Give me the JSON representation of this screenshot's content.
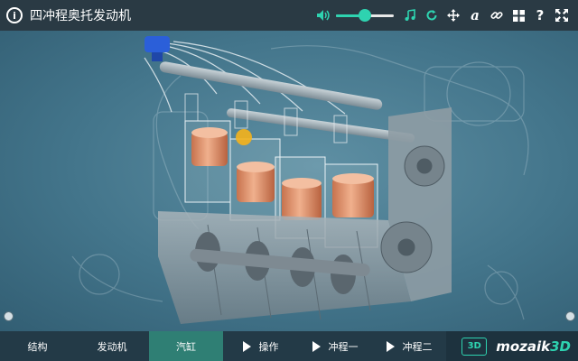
{
  "app": {
    "title": "四冲程奥托发动机",
    "info_glyph": "i"
  },
  "toolbar": {
    "volume_icon": "speaker-icon",
    "volume_level": 0.5,
    "music_icon": "music-note-icon",
    "reset_icon": "rotate-icon",
    "move_icon": "move-arrows-icon",
    "label_glyph": "a",
    "link_icon": "link-icon",
    "grid_icon": "grid-icon",
    "help_glyph": "?",
    "fullscreen_icon": "fullscreen-icon"
  },
  "tabs": [
    {
      "label": "结构",
      "play": false,
      "active": false
    },
    {
      "label": "发动机",
      "play": false,
      "active": false
    },
    {
      "label": "汽缸",
      "play": false,
      "active": true
    },
    {
      "label": "操作",
      "play": true,
      "active": false
    },
    {
      "label": "冲程一",
      "play": true,
      "active": false
    },
    {
      "label": "冲程二",
      "play": true,
      "active": false
    }
  ],
  "brand": {
    "badge": "3D",
    "name": "mozaik",
    "name_suffix": "3D"
  },
  "colors": {
    "accent": "#2ed3b0",
    "topbar": "#2a3a44",
    "bottombar": "#233a47",
    "active_tab": "#2f7f74",
    "piston": "#e39a73"
  }
}
